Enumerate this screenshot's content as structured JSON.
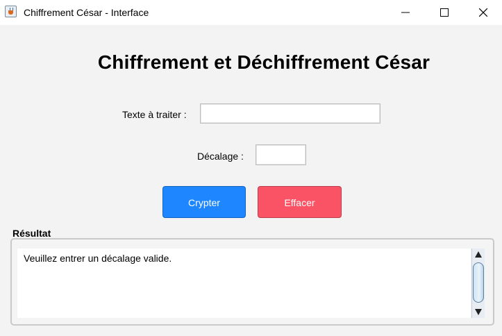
{
  "window": {
    "title": "Chiffrement César - Interface",
    "controls": [
      "minimize",
      "maximize",
      "close"
    ]
  },
  "heading": "Chiffrement et Déchiffrement César",
  "form": {
    "text_label": "Texte à traiter :",
    "text_value": "",
    "shift_label": "Décalage :",
    "shift_value": ""
  },
  "buttons": {
    "crypt_label": "Crypter",
    "clear_label": "Effacer",
    "crypt_color": "#1e86ff",
    "clear_color": "#fb5366"
  },
  "result": {
    "label": "Résultat",
    "text": "Veuillez entrer un décalage valide."
  }
}
